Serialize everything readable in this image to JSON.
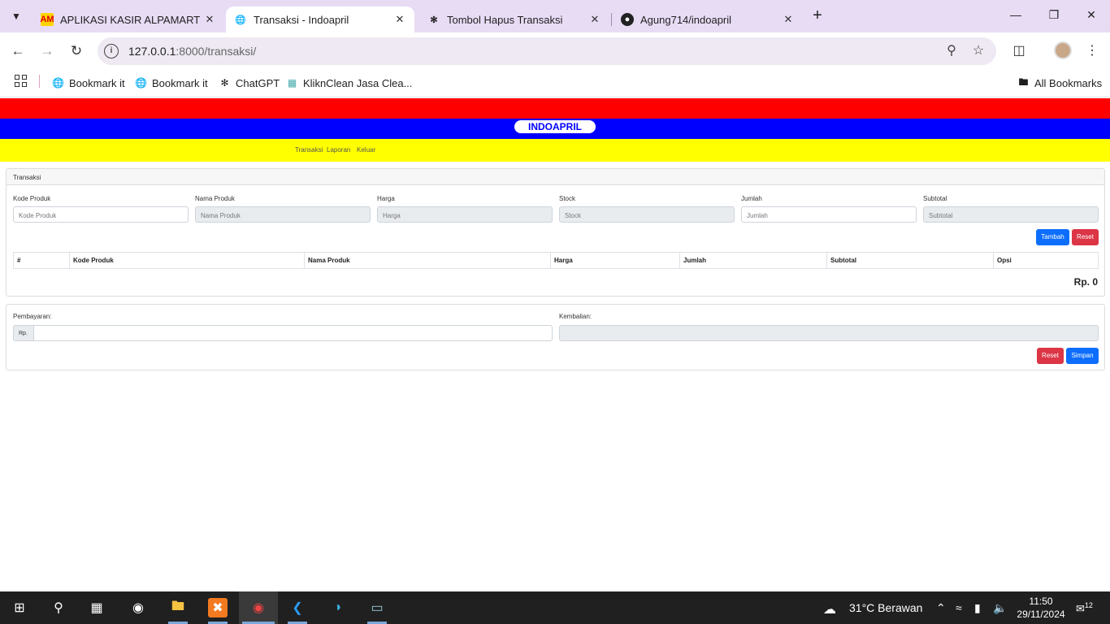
{
  "browser": {
    "tabs": [
      {
        "title": "APLIKASI KASIR ALPAMART",
        "favicon": "AM"
      },
      {
        "title": "Transaksi - Indoapril",
        "favicon": "globe-icon"
      },
      {
        "title": "Tombol Hapus Transaksi",
        "favicon": "chatgpt-icon"
      },
      {
        "title": "Agung714/indoapril",
        "favicon": "github-icon"
      }
    ],
    "url_host": "127.0.0.1",
    "url_path": ":8000/transaksi/",
    "bookmarks": [
      "Bookmark it",
      "Bookmark it",
      "ChatGPT",
      "KliknClean Jasa Clea..."
    ],
    "all_bookmarks": "All Bookmarks"
  },
  "page": {
    "brand": "INDOAPRIL",
    "nav": [
      "Transaksi",
      "Laporan",
      "Keluar"
    ],
    "card_title": "Transaksi",
    "fields": {
      "kode_label": "Kode Produk",
      "kode_ph": "Kode Produk",
      "nama_label": "Nama Produk",
      "nama_ph": "Nama Produk",
      "harga_label": "Harga",
      "harga_ph": "Harga",
      "stock_label": "Stock",
      "stock_ph": "Stock",
      "jumlah_label": "Jumlah",
      "jumlah_ph": "Jumlah",
      "subtotal_label": "Subtotal",
      "subtotal_ph": "Subtotal"
    },
    "buttons": {
      "tambah": "Tambah",
      "reset": "Reset",
      "reset2": "Reset",
      "simpan": "Simpan"
    },
    "table_headers": [
      "#",
      "Kode Produk",
      "Nama Produk",
      "Harga",
      "Jumlah",
      "Subtotal",
      "Opsi"
    ],
    "total": "Rp. 0",
    "payment": {
      "pembayaran_label": "Pembayaran:",
      "addon": "Rp.",
      "kembalian_label": "Kembalian:"
    }
  },
  "taskbar": {
    "weather": "31°C  Berawan",
    "time": "11:50",
    "date": "29/11/2024",
    "notifications": "12"
  },
  "colors": {
    "red_band": "#ff0000",
    "blue_band": "#0000ff",
    "yellow_band": "#ffff00"
  }
}
